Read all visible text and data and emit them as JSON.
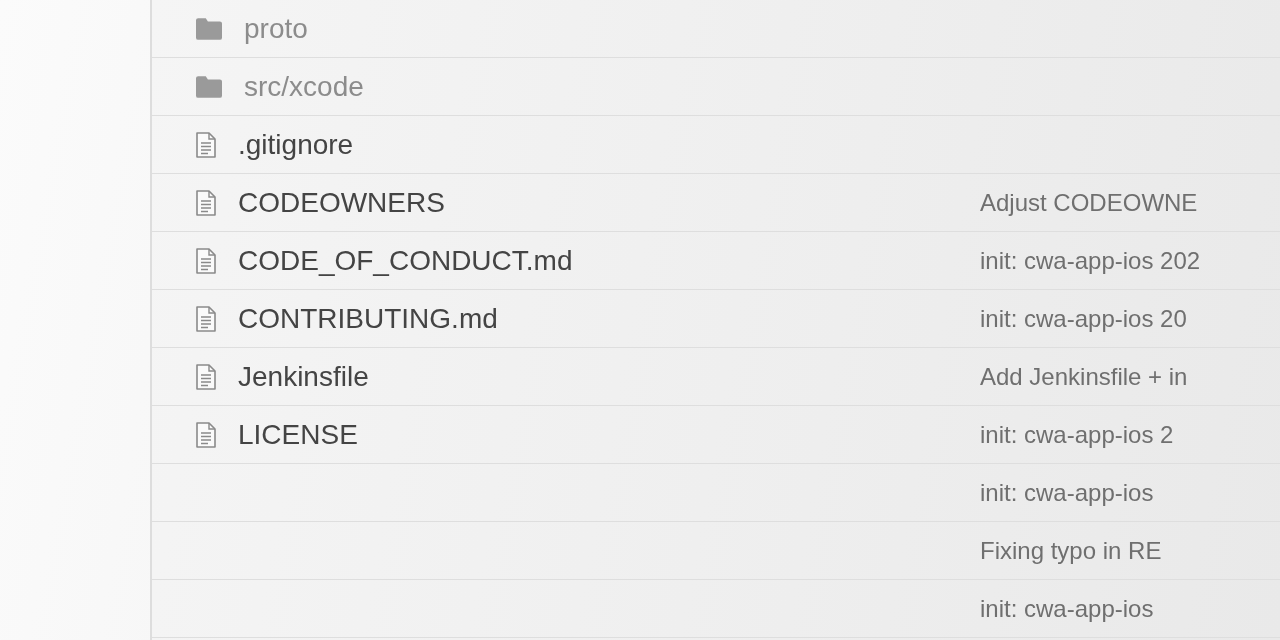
{
  "files": [
    {
      "kind": "folder",
      "name": "proto"
    },
    {
      "kind": "folder",
      "name": "src/xcode"
    },
    {
      "kind": "file",
      "name": ".gitignore"
    },
    {
      "kind": "file",
      "name": "CODEOWNERS",
      "message": "Adjust CODEOWNE"
    },
    {
      "kind": "file",
      "name": "CODE_OF_CONDUCT.md",
      "message": "init: cwa-app-ios 202"
    },
    {
      "kind": "file",
      "name": "CONTRIBUTING.md",
      "message": "init: cwa-app-ios 20"
    },
    {
      "kind": "file",
      "name": "Jenkinsfile",
      "message": "Add Jenkinsfile + in"
    },
    {
      "kind": "file",
      "name": "LICENSE",
      "message": "init: cwa-app-ios 2"
    },
    {
      "message": "init: cwa-app-ios"
    },
    {
      "message": "Fixing typo in RE"
    },
    {
      "message": "init: cwa-app-ios"
    }
  ]
}
